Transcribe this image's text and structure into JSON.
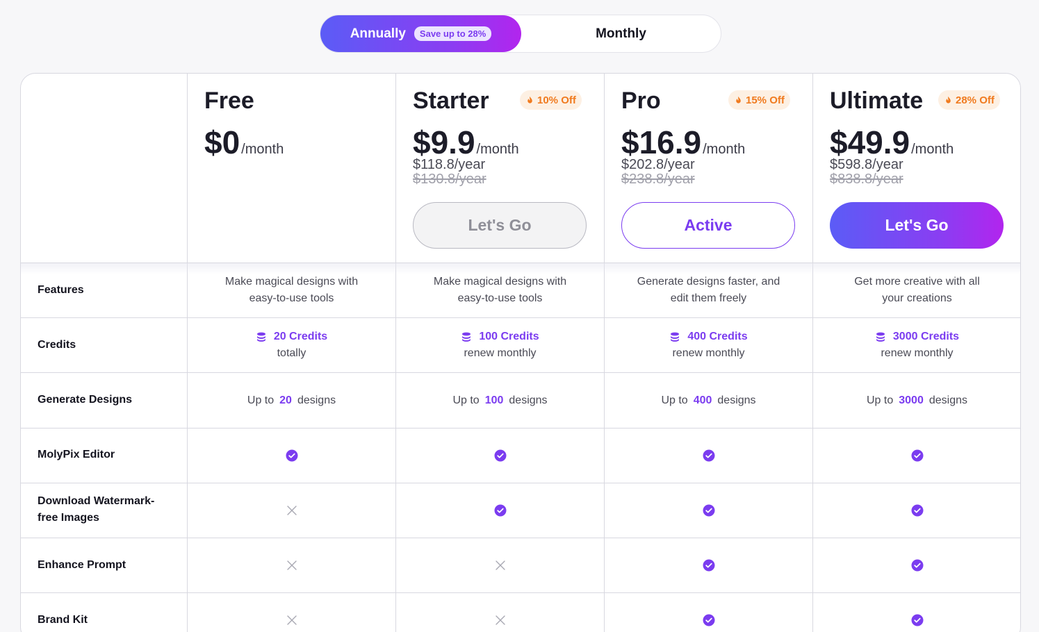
{
  "toggle": {
    "annual_label": "Annually",
    "save_badge": "Save up to 28%",
    "monthly_label": "Monthly"
  },
  "plans": [
    {
      "name": "Free",
      "price": "$0",
      "per": "/month",
      "credits": "20 Credits",
      "credits_note": "totally",
      "feature_text": [
        "Make magical designs with",
        "easy-to-use tools"
      ],
      "designs_num": "20"
    },
    {
      "name": "Starter",
      "badge": "10% Off",
      "price": "$9.9",
      "per": "/month",
      "year_price": "$118.8/year",
      "orig_price": "$130.8/year",
      "cta": "Let's Go",
      "credits": "100 Credits",
      "credits_note": "renew monthly",
      "feature_text": [
        "Make magical designs with",
        "easy-to-use tools"
      ],
      "designs_num": "100"
    },
    {
      "name": "Pro",
      "badge": "15% Off",
      "price": "$16.9",
      "per": "/month",
      "year_price": "$202.8/year",
      "orig_price": "$238.8/year",
      "cta": "Active",
      "credits": "400 Credits",
      "credits_note": "renew monthly",
      "feature_text": [
        "Generate designs faster, and",
        "edit them freely"
      ],
      "designs_num": "400"
    },
    {
      "name": "Ultimate",
      "badge": "28% Off",
      "price": "$49.9",
      "per": "/month",
      "year_price": "$598.8/year",
      "orig_price": "$838.8/year",
      "cta": "Let's Go",
      "credits": "3000 Credits",
      "credits_note": "renew monthly",
      "feature_text": [
        "Get more creative with all",
        "your creations"
      ],
      "designs_num": "3000"
    }
  ],
  "rows": {
    "features": "Features",
    "credits": "Credits",
    "generate": "Generate Designs",
    "editor": "MolyPix Editor",
    "watermark_1": "Download Watermark-",
    "watermark_2": "free Images",
    "enhance": "Enhance Prompt",
    "brand": "Brand Kit"
  },
  "designs_prefix": "Up to",
  "designs_suffix": "designs",
  "availability": {
    "editor": [
      true,
      true,
      true,
      true
    ],
    "watermark": [
      false,
      true,
      true,
      true
    ],
    "enhance": [
      false,
      false,
      true,
      true
    ],
    "brand": [
      false,
      false,
      true,
      true
    ]
  },
  "colors": {
    "accent": "#7b3cf0",
    "gradient_start": "#5b5cf6",
    "gradient_end": "#b225ee",
    "badge_orange": "#f07a1e"
  }
}
